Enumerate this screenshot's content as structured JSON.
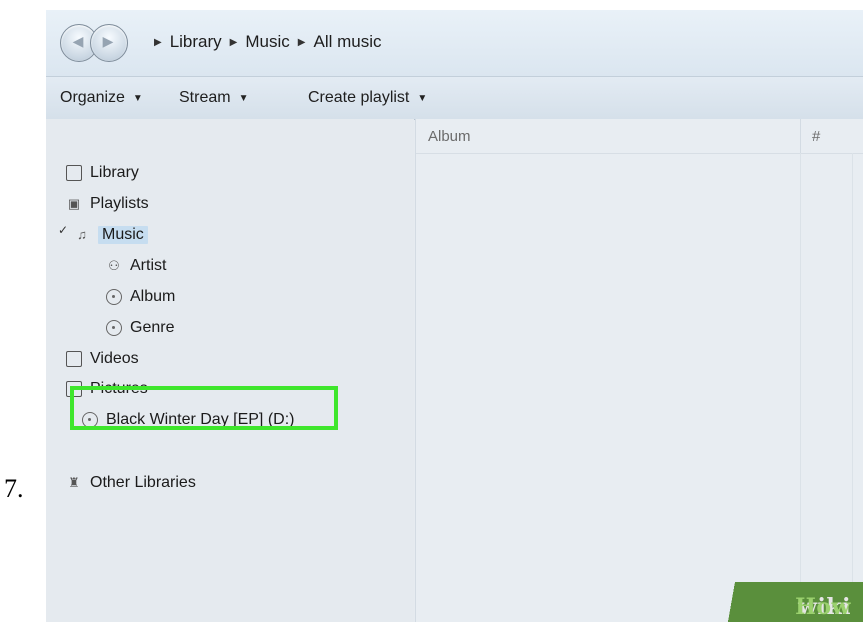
{
  "step_number": "7.",
  "breadcrumb": [
    "Library",
    "Music",
    "All music"
  ],
  "toolbar": {
    "organize": "Organize",
    "stream": "Stream",
    "create_playlist": "Create playlist"
  },
  "nav": {
    "library": "Library",
    "playlists": "Playlists",
    "music": "Music",
    "artist": "Artist",
    "album": "Album",
    "genre": "Genre",
    "videos": "Videos",
    "pictures": "Pictures",
    "drive": "Black Winter Day [EP] (D:)",
    "other_libraries": "Other Libraries"
  },
  "columns": {
    "album": "Album",
    "number": "#"
  },
  "watermark": {
    "wiki": "wiki",
    "how": "How"
  },
  "colors": {
    "highlight_border": "#3ee62c",
    "music_selected_bg": "#c6ddf0"
  }
}
